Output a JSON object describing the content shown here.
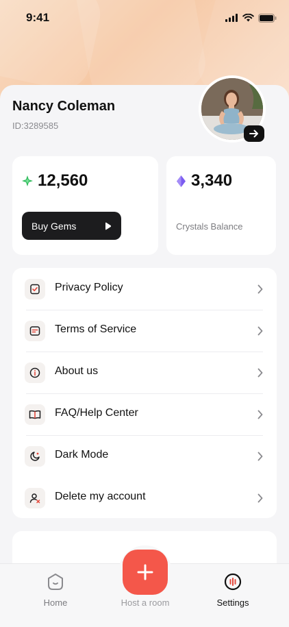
{
  "status_bar": {
    "time": "9:41"
  },
  "profile": {
    "name": "Nancy Coleman",
    "id_text": "ID:3289585"
  },
  "wallet": {
    "gems_amount": "12,560",
    "buy_gems_label": "Buy Gems",
    "crystals_amount": "3,340",
    "crystals_label": "Crystals Balance"
  },
  "menu": {
    "items": [
      {
        "label": "Privacy Policy",
        "icon": "shield-check-icon"
      },
      {
        "label": "Terms of Service",
        "icon": "document-icon"
      },
      {
        "label": "About us",
        "icon": "info-icon"
      },
      {
        "label": "FAQ/Help Center",
        "icon": "book-icon"
      },
      {
        "label": "Dark Mode",
        "icon": "moon-icon"
      },
      {
        "label": "Delete my account",
        "icon": "user-remove-icon"
      }
    ]
  },
  "tabbar": {
    "home_label": "Home",
    "host_label": "Host a room",
    "settings_label": "Settings"
  },
  "colors": {
    "accent": "#f4574a",
    "gem_green": "#2dbb5a",
    "crystal_purple": "#7b5cf0",
    "dark": "#1c1c1e"
  }
}
